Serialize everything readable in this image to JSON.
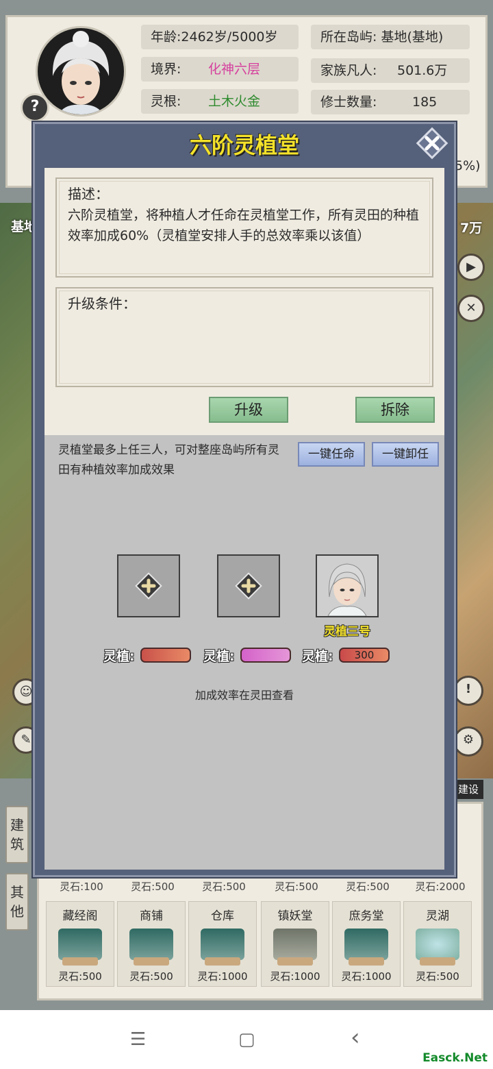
{
  "status": {
    "age": {
      "label": "年龄:",
      "value": "2462岁/5000岁"
    },
    "realm": {
      "label": "境界:",
      "value": "化神六层"
    },
    "root": {
      "label": "灵根:",
      "value": "土木火金"
    },
    "island": {
      "label": "所在岛屿:",
      "value": "基地(基地)"
    },
    "mortals": {
      "label": "家族凡人:",
      "value": "501.6万"
    },
    "cultivators": {
      "label": "修士数量:",
      "value": "185"
    },
    "partial_right": "5%)",
    "help": "?"
  },
  "map": {
    "label_left": "基地",
    "label_right": "7万",
    "build_tag": "建设"
  },
  "side_tabs": {
    "build": "建筑",
    "other": "其他"
  },
  "buildings": {
    "top_costs": [
      "灵石:100",
      "灵石:500",
      "灵石:500",
      "灵石:500",
      "灵石:500",
      "灵石:2000"
    ],
    "items": [
      {
        "name": "藏经阁",
        "cost": "灵石:500"
      },
      {
        "name": "商铺",
        "cost": "灵石:500"
      },
      {
        "name": "仓库",
        "cost": "灵石:1000"
      },
      {
        "name": "镇妖堂",
        "cost": "灵石:1000"
      },
      {
        "name": "庶务堂",
        "cost": "灵石:1000"
      },
      {
        "name": "灵湖",
        "cost": "灵石:500"
      }
    ]
  },
  "modal": {
    "title": "六阶灵植堂",
    "description_title": "描述：",
    "description": "六阶灵植堂，将种植人才任命在灵植堂工作，所有灵田的种植效率加成60%（灵植堂安排人手的总效率乘以该值）",
    "upgrade_title": "升级条件：",
    "upgrade_button": "升级",
    "demolish_button": "拆除",
    "staff_info": "灵植堂最多上任三人，可对整座岛屿所有灵田有种植效率加成效果",
    "appoint_all": "一键任命",
    "dismiss_all": "一键卸任",
    "slots": [
      {
        "occupied": false,
        "name": "",
        "bar_label": "灵植:",
        "bar_value": "",
        "bar_color": "#c9524a"
      },
      {
        "occupied": false,
        "name": "",
        "bar_label": "灵植:",
        "bar_value": "",
        "bar_color": "#d462c9"
      },
      {
        "occupied": true,
        "name": "灵植三号",
        "bar_label": "灵植:",
        "bar_value": "300",
        "bar_color": "#c94a4a"
      }
    ],
    "note": "加成效率在灵田查看"
  },
  "navbar": {
    "menu_icon": "☰",
    "home_icon": "▢",
    "back_icon": "‹"
  },
  "watermark": "Easck.Net",
  "colors": {
    "modal_bg": "#55607a",
    "title_yellow": "#f3e12a",
    "realm_pink": "#d6409e",
    "root_green": "#2f8b2f"
  }
}
